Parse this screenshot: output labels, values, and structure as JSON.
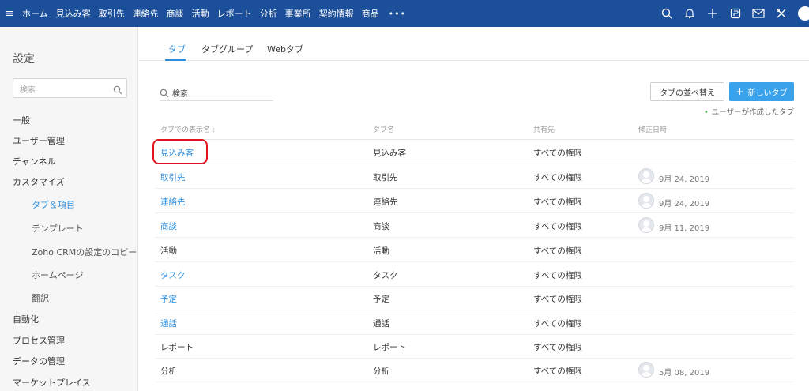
{
  "topnav": {
    "menu_icon": "hamburger-icon",
    "items": [
      "ホーム",
      "見込み客",
      "取引先",
      "連絡先",
      "商談",
      "活動",
      "レポート",
      "分析",
      "事業所",
      "契約情報",
      "商品"
    ],
    "more": "•••",
    "icons": [
      "search-icon",
      "bell-icon",
      "plus-icon",
      "calendar-icon",
      "mail-icon",
      "tools-icon",
      "user-avatar-icon"
    ]
  },
  "sidebar": {
    "title": "設定",
    "search_placeholder": "検索",
    "items": [
      {
        "label": "一般",
        "level": 0
      },
      {
        "label": "ユーザー管理",
        "level": 0
      },
      {
        "label": "チャンネル",
        "level": 0
      },
      {
        "label": "カスタマイズ",
        "level": 0
      },
      {
        "label": "タブ＆項目",
        "level": 1,
        "active": true
      },
      {
        "label": "テンプレート",
        "level": 1
      },
      {
        "label": "Zoho CRMの設定のコピー",
        "level": 1
      },
      {
        "label": "ホームページ",
        "level": 1
      },
      {
        "label": "翻訳",
        "level": 1
      },
      {
        "label": "自動化",
        "level": 0
      },
      {
        "label": "プロセス管理",
        "level": 0
      },
      {
        "label": "データの管理",
        "level": 0
      },
      {
        "label": "マーケットプレイス",
        "level": 0
      }
    ]
  },
  "tabs": [
    {
      "label": "タブ",
      "active": true
    },
    {
      "label": "タブグループ",
      "active": false
    },
    {
      "label": "Webタブ",
      "active": false
    }
  ],
  "search": {
    "placeholder": "検索"
  },
  "buttons": {
    "reorder": "タブの並べ替え",
    "new_tab": "新しいタブ"
  },
  "legend": "ユーザーが作成したタブ",
  "table": {
    "headers": [
      "タブでの表示名 :",
      "タブ名",
      "共有先",
      "修正日時"
    ],
    "rows": [
      {
        "display": "見込み客",
        "name": "見込み客",
        "shared": "すべての権限",
        "modified": "",
        "link": true
      },
      {
        "display": "取引先",
        "name": "取引先",
        "shared": "すべての権限",
        "modified": "9月 24, 2019",
        "link": true
      },
      {
        "display": "連絡先",
        "name": "連絡先",
        "shared": "すべての権限",
        "modified": "9月 24, 2019",
        "link": true
      },
      {
        "display": "商談",
        "name": "商談",
        "shared": "すべての権限",
        "modified": "9月 11, 2019",
        "link": true
      },
      {
        "display": "活動",
        "name": "活動",
        "shared": "すべての権限",
        "modified": "",
        "link": false
      },
      {
        "display": "タスク",
        "name": "タスク",
        "shared": "すべての権限",
        "modified": "",
        "link": true
      },
      {
        "display": "予定",
        "name": "予定",
        "shared": "すべての権限",
        "modified": "",
        "link": true
      },
      {
        "display": "通話",
        "name": "通話",
        "shared": "すべての権限",
        "modified": "",
        "link": true
      },
      {
        "display": "レポート",
        "name": "レポート",
        "shared": "すべての権限",
        "modified": "",
        "link": false
      },
      {
        "display": "分析",
        "name": "分析",
        "shared": "すべての権限",
        "modified": "5月 08, 2019",
        "link": false
      }
    ]
  },
  "colors": {
    "nav_bg": "#1b4f9a",
    "link": "#2c8fe0",
    "primary_button": "#3aa2ea",
    "annotation": "#e0141c",
    "legend_dot": "#4caf50"
  }
}
